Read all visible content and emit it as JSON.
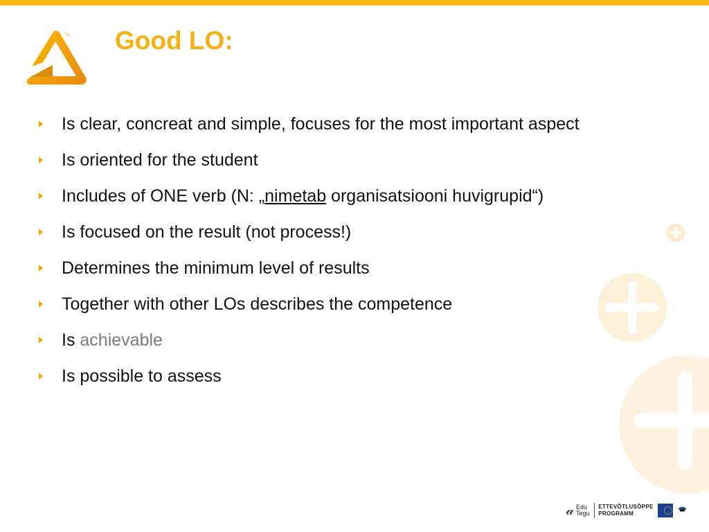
{
  "header": {
    "title": "Good LO:",
    "logo_icon": "orange-triangle-logo-icon",
    "accent_color": "#FDB813",
    "title_color": "#F6B012"
  },
  "bullets": [
    {
      "text": "Is clear, concreat and simple, focuses for the most important aspect"
    },
    {
      "text": "Is oriented for the student"
    },
    {
      "prefix": "Includes of ONE verb (N: „",
      "underlined": "nimetab",
      "suffix": " organisatsiooni huvigrupid“)"
    },
    {
      "text": "Is focused on the result (not process!)"
    },
    {
      "text": "Determines the minimum level of results"
    },
    {
      "text": "Together with other LOs describes the competence"
    },
    {
      "prefix": "Is ",
      "gray": "achievable"
    },
    {
      "text": "Is possible to assess"
    }
  ],
  "bullet_icon": "triangle-right-icon",
  "decorations": [
    "plus-circle-icon",
    "plus-circle-icon",
    "plus-circle-icon"
  ],
  "footer": {
    "edu_line1": "Edu",
    "edu_line2": "Tegu",
    "program_line1": "ETTEVÕTLUSÕPPE",
    "program_line2": "PROGRAMM",
    "eu_logo": "eu-flag-icon",
    "estonia_logo": "estonian-coat-icon"
  }
}
